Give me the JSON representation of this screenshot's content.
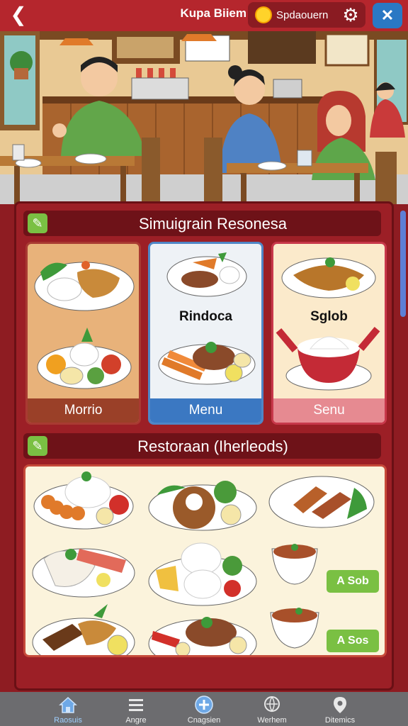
{
  "header": {
    "title": "Kupa Biiem",
    "coin_label": "Spdaouern"
  },
  "section1": {
    "title": "Simuigrain Resonesa",
    "cards": [
      {
        "label": "Morrio",
        "mid_label": ""
      },
      {
        "label": "Menu",
        "mid_label": "Rindoca"
      },
      {
        "label": "Senu",
        "mid_label": "Sglob"
      }
    ]
  },
  "section2": {
    "title": "Restoraan (Iherleods)",
    "price_badges": [
      "A Sob",
      "A Sos"
    ]
  },
  "nav": {
    "items": [
      {
        "label": "Raosuis",
        "icon": "home-icon"
      },
      {
        "label": "Angre",
        "icon": "menu-icon"
      },
      {
        "label": "Cnagsien",
        "icon": "plus-icon"
      },
      {
        "label": "Werhem",
        "icon": "globe-icon"
      },
      {
        "label": "Ditemics",
        "icon": "pin-icon"
      }
    ]
  },
  "colors": {
    "topbar": "#b5262d",
    "panel": "#9c1f26",
    "accent_green": "#7ac043",
    "accent_blue": "#3b78c2"
  }
}
